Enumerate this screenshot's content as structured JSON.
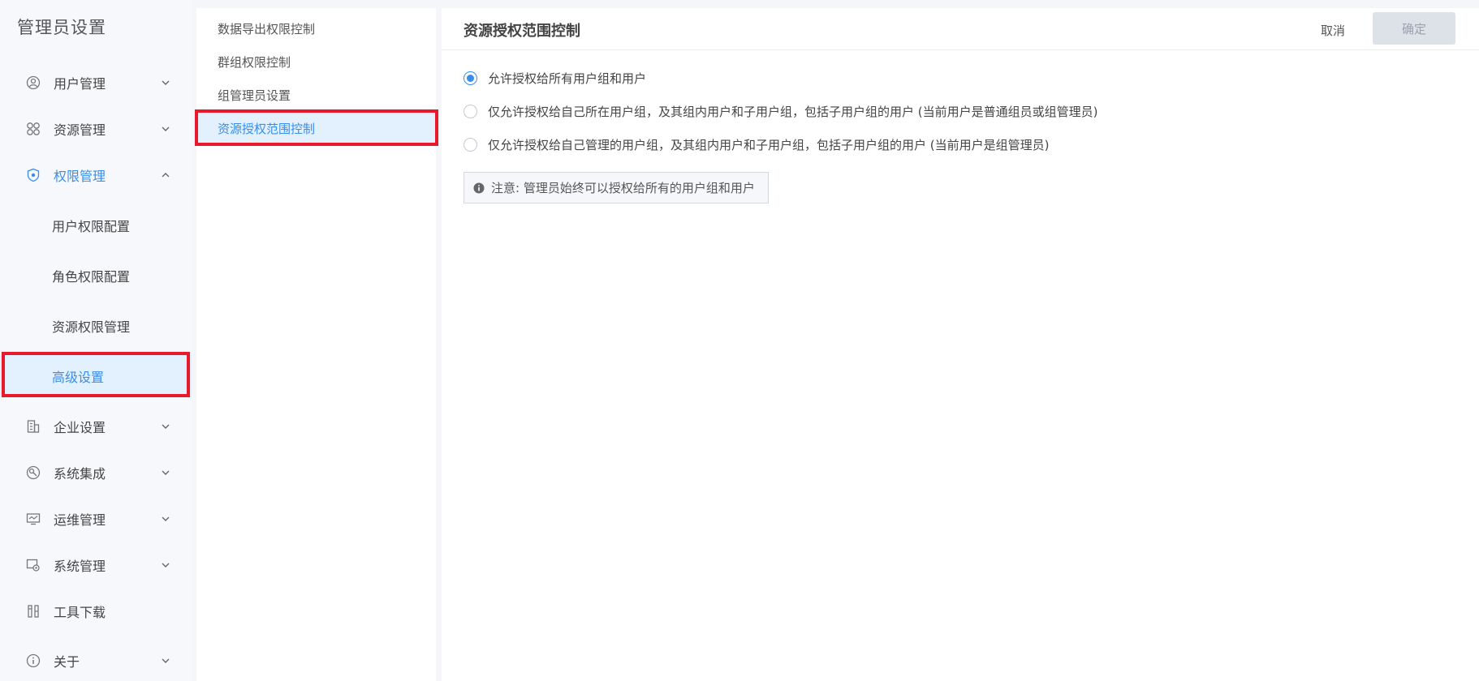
{
  "sidebar": {
    "title": "管理员设置",
    "items": [
      {
        "label": "用户管理",
        "icon": "user-circle-icon"
      },
      {
        "label": "资源管理",
        "icon": "grid-icon"
      },
      {
        "label": "权限管理",
        "icon": "shield-icon"
      },
      {
        "label": "企业设置",
        "icon": "building-icon"
      },
      {
        "label": "系统集成",
        "icon": "integration-icon"
      },
      {
        "label": "运维管理",
        "icon": "monitor-icon"
      },
      {
        "label": "系统管理",
        "icon": "system-gear-icon"
      },
      {
        "label": "工具下载",
        "icon": "tools-icon"
      },
      {
        "label": "关于",
        "icon": "info-circle-icon"
      }
    ],
    "permission_sub_items": [
      {
        "label": "用户权限配置"
      },
      {
        "label": "角色权限配置"
      },
      {
        "label": "资源权限管理"
      },
      {
        "label": "高级设置"
      }
    ],
    "accent_color": "#3a8ee6"
  },
  "middle_menu": {
    "items": [
      {
        "label": "数据导出权限控制"
      },
      {
        "label": "群组权限控制"
      },
      {
        "label": "组管理员设置"
      },
      {
        "label": "资源授权范围控制"
      }
    ]
  },
  "main": {
    "title": "资源授权范围控制",
    "cancel_label": "取消",
    "confirm_label": "确定",
    "options": [
      {
        "label": "允许授权给所有用户组和用户",
        "checked": true
      },
      {
        "label": "仅允许授权给自己所在用户组，及其组内用户和子用户组，包括子用户组的用户 (当前用户是普通组员或组管理员)",
        "checked": false
      },
      {
        "label": "仅允许授权给自己管理的用户组，及其组内用户和子用户组，包括子用户组的用户 (当前用户是组管理员)",
        "checked": false
      }
    ],
    "notice": "注意: 管理员始终可以授权给所有的用户组和用户"
  },
  "highlight_color": "#e8192c"
}
